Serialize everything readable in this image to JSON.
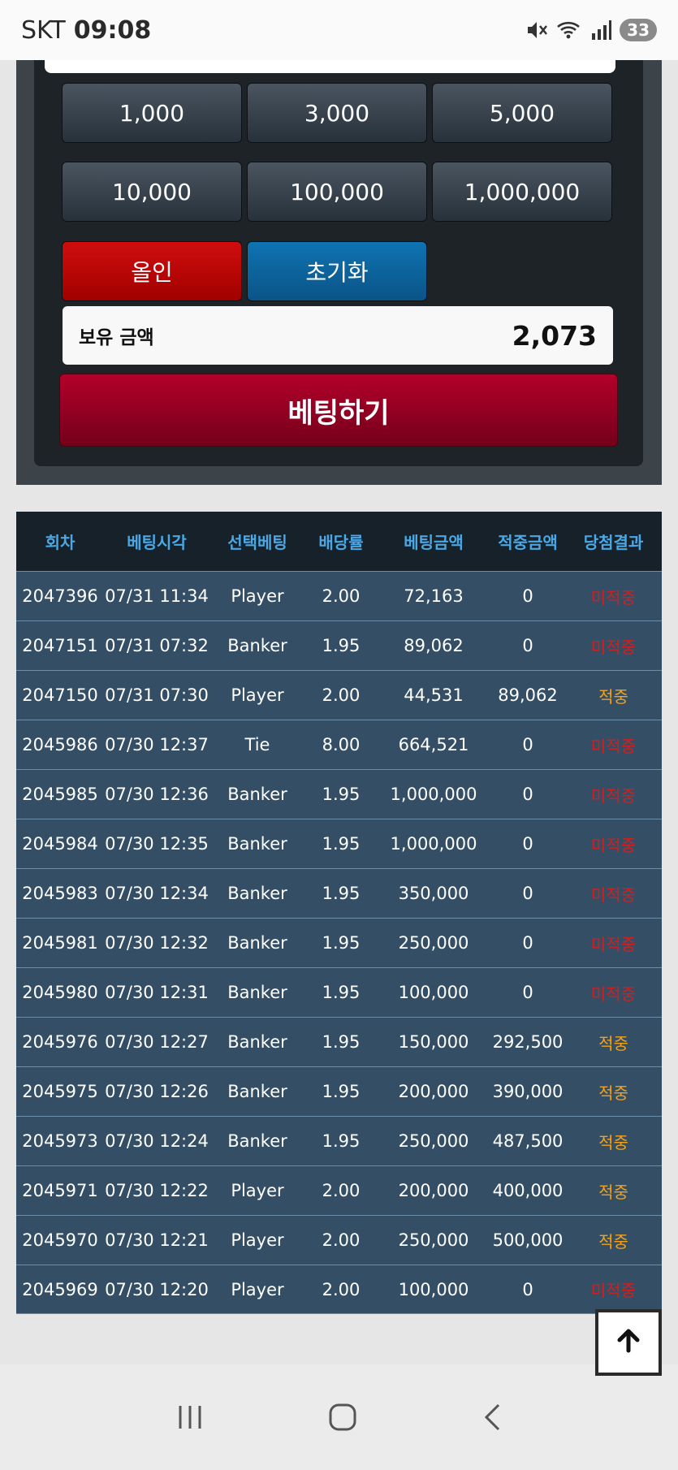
{
  "status_bar": {
    "carrier": "SKT",
    "time": "09:08",
    "battery": "33",
    "wifi_label": "6"
  },
  "chips": [
    "1,000",
    "3,000",
    "5,000",
    "10,000",
    "100,000",
    "1,000,000"
  ],
  "actions": {
    "all_in": "올인",
    "reset": "초기화"
  },
  "balance": {
    "label": "보유 금액",
    "value": "2,073"
  },
  "bet_button": "베팅하기",
  "history": {
    "headers": [
      "회차",
      "베팅시각",
      "선택베팅",
      "배당률",
      "베팅금액",
      "적중금액",
      "당첨결과"
    ],
    "rows": [
      [
        "2047396",
        "07/31 11:34",
        "Player",
        "2.00",
        "72,163",
        "0",
        "미적중"
      ],
      [
        "2047151",
        "07/31 07:32",
        "Banker",
        "1.95",
        "89,062",
        "0",
        "미적중"
      ],
      [
        "2047150",
        "07/31 07:30",
        "Player",
        "2.00",
        "44,531",
        "89,062",
        "적중"
      ],
      [
        "2045986",
        "07/30 12:37",
        "Tie",
        "8.00",
        "664,521",
        "0",
        "미적중"
      ],
      [
        "2045985",
        "07/30 12:36",
        "Banker",
        "1.95",
        "1,000,000",
        "0",
        "미적중"
      ],
      [
        "2045984",
        "07/30 12:35",
        "Banker",
        "1.95",
        "1,000,000",
        "0",
        "미적중"
      ],
      [
        "2045983",
        "07/30 12:34",
        "Banker",
        "1.95",
        "350,000",
        "0",
        "미적중"
      ],
      [
        "2045981",
        "07/30 12:32",
        "Banker",
        "1.95",
        "250,000",
        "0",
        "미적중"
      ],
      [
        "2045980",
        "07/30 12:31",
        "Banker",
        "1.95",
        "100,000",
        "0",
        "미적중"
      ],
      [
        "2045976",
        "07/30 12:27",
        "Banker",
        "1.95",
        "150,000",
        "292,500",
        "적중"
      ],
      [
        "2045975",
        "07/30 12:26",
        "Banker",
        "1.95",
        "200,000",
        "390,000",
        "적중"
      ],
      [
        "2045973",
        "07/30 12:24",
        "Banker",
        "1.95",
        "250,000",
        "487,500",
        "적중"
      ],
      [
        "2045971",
        "07/30 12:22",
        "Player",
        "2.00",
        "200,000",
        "400,000",
        "적중"
      ],
      [
        "2045970",
        "07/30 12:21",
        "Player",
        "2.00",
        "250,000",
        "500,000",
        "적중"
      ],
      [
        "2045969",
        "07/30 12:20",
        "Player",
        "2.00",
        "100,000",
        "0",
        "미적중"
      ]
    ]
  },
  "colors": {
    "win": "#f2a31b",
    "lose": "#d41e1e",
    "header_text": "#4aa8e6",
    "row_bg": "#344f65"
  }
}
